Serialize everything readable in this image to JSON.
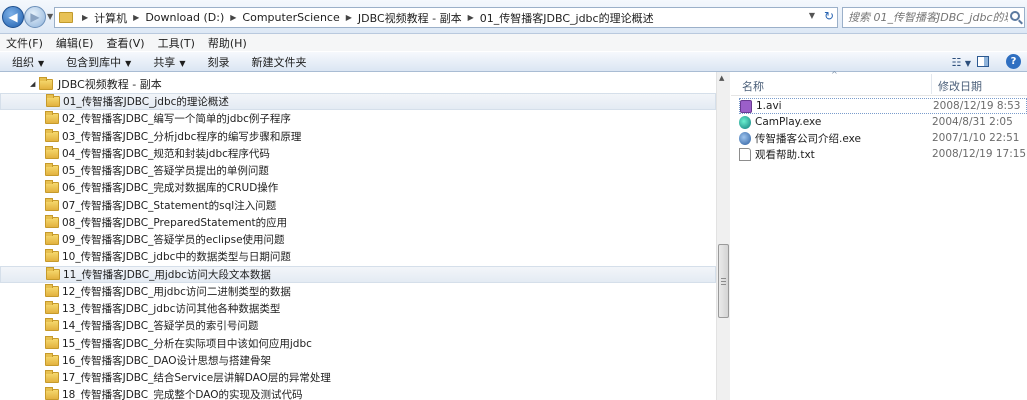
{
  "address": {
    "crumbs": [
      "计算机",
      "Download (D:)",
      "ComputerScience",
      "JDBC视频教程 - 副本",
      "01_传智播客JDBC_jdbc的理论概述"
    ],
    "search_placeholder": "搜索 01_传智播客JDBC_jdbc的理论..."
  },
  "menu": [
    "文件(F)",
    "编辑(E)",
    "查看(V)",
    "工具(T)",
    "帮助(H)"
  ],
  "commands": {
    "organize": "组织",
    "include_library": "包含到库中",
    "share": "共享",
    "burn": "刻录",
    "new_folder": "新建文件夹"
  },
  "tree": {
    "parent": "JDBC视频教程 - 副本",
    "items": [
      "01_传智播客JDBC_jdbc的理论概述",
      "02_传智播客JDBC_编写一个简单的jdbc例子程序",
      "03_传智播客JDBC_分析jdbc程序的编写步骤和原理",
      "04_传智播客JDBC_规范和封装jdbc程序代码",
      "05_传智播客JDBC_答疑学员提出的单例问题",
      "06_传智播客JDBC_完成对数据库的CRUD操作",
      "07_传智播客JDBC_Statement的sql注入问题",
      "08_传智播客JDBC_PreparedStatement的应用",
      "09_传智播客JDBC_答疑学员的eclipse使用问题",
      "10_传智播客JDBC_jdbc中的数据类型与日期问题",
      "11_传智播客JDBC_用jdbc访问大段文本数据",
      "12_传智播客JDBC_用jdbc访问二进制类型的数据",
      "13_传智播客JDBC_jdbc访问其他各种数据类型",
      "14_传智播客JDBC_答疑学员的索引号问题",
      "15_传智播客JDBC_分析在实际项目中该如何应用jdbc",
      "16_传智播客JDBC_DAO设计思想与搭建骨架",
      "17_传智播客JDBC_结合Service层讲解DAO层的异常处理",
      "18_传智播客JDBC_完成整个DAO的实现及测试代码"
    ]
  },
  "files": {
    "col_name": "名称",
    "col_date": "修改日期",
    "rows": [
      {
        "name": "1.avi",
        "date": "2008/12/19 8:53"
      },
      {
        "name": "CamPlay.exe",
        "date": "2004/8/31 2:05"
      },
      {
        "name": "传智播客公司介绍.exe",
        "date": "2007/1/10 22:51"
      },
      {
        "name": "观看帮助.txt",
        "date": "2008/12/19 17:15"
      }
    ]
  },
  "icons": {
    "back": "back-arrow-icon",
    "forward": "forward-arrow-icon",
    "refresh": "refresh-icon",
    "search": "search-icon",
    "folder": "folder-icon"
  }
}
